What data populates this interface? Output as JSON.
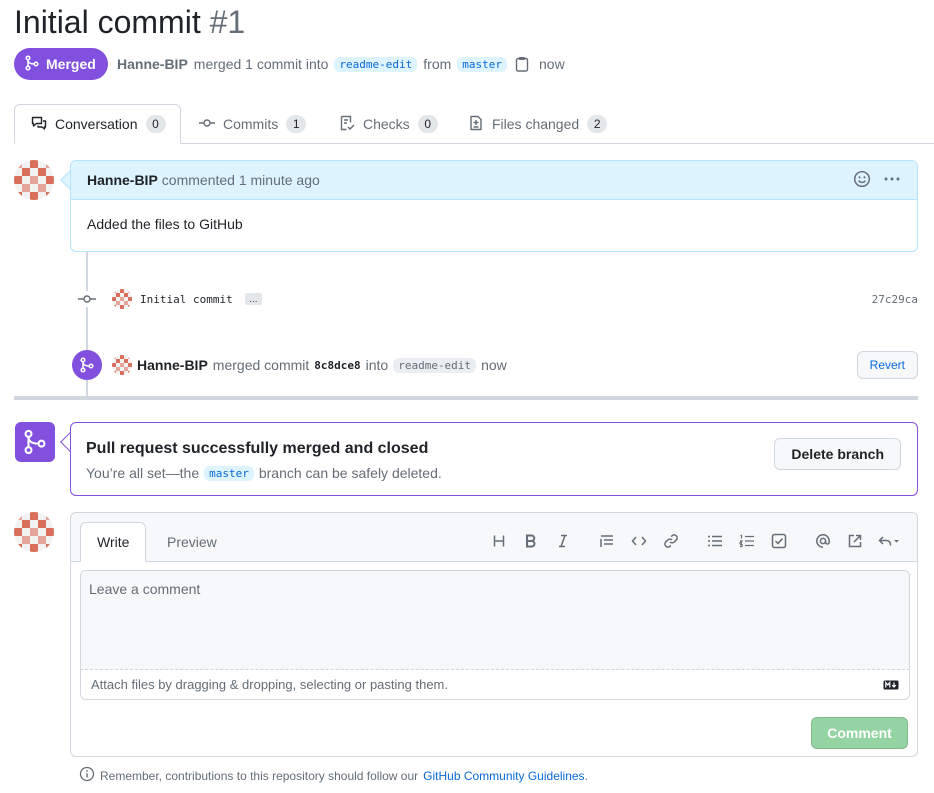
{
  "pr": {
    "title": "Initial commit",
    "number": "#1",
    "state": "Merged",
    "author": "Hanne-BIP",
    "merged_text": "merged 1 commit into",
    "base_branch": "readme-edit",
    "from_text": "from",
    "head_branch": "master",
    "time": "now"
  },
  "tabs": [
    {
      "label": "Conversation",
      "count": "0",
      "icon": "comment-discussion-icon"
    },
    {
      "label": "Commits",
      "count": "1",
      "icon": "git-commit-icon"
    },
    {
      "label": "Checks",
      "count": "0",
      "icon": "checklist-icon"
    },
    {
      "label": "Files changed",
      "count": "2",
      "icon": "file-diff-icon"
    }
  ],
  "comment": {
    "author": "Hanne-BIP",
    "action": "commented 1 minute ago",
    "body": "Added the files to GitHub"
  },
  "commit": {
    "message": "Initial commit",
    "ellipsis": "…",
    "sha": "27c29ca"
  },
  "merge_event": {
    "author": "Hanne-BIP",
    "text": "merged commit",
    "sha": "8c8dce8",
    "into": "into",
    "branch": "readme-edit",
    "time": "now",
    "revert_label": "Revert"
  },
  "merge_box": {
    "heading": "Pull request successfully merged and closed",
    "sub_before": "You’re all set—the",
    "branch": "master",
    "sub_after": "branch can be safely deleted.",
    "delete_label": "Delete branch"
  },
  "editor": {
    "write_tab": "Write",
    "preview_tab": "Preview",
    "placeholder": "Leave a comment",
    "attach_text": "Attach files by dragging & dropping, selecting or pasting them.",
    "submit_label": "Comment",
    "toolbar": [
      "heading-icon",
      "bold-icon",
      "italic-icon",
      "quote-icon",
      "code-icon",
      "link-icon",
      "unordered-list-icon",
      "ordered-list-icon",
      "task-list-icon",
      "mention-icon",
      "cross-reference-icon",
      "reply-icon"
    ]
  },
  "footer": {
    "text": "Remember, contributions to this repository should follow our",
    "link": "GitHub Community Guidelines",
    "end": "."
  },
  "colors": {
    "merged": "#8250df",
    "link": "#0969da",
    "comment_btn_disabled": "#94d3a2"
  }
}
